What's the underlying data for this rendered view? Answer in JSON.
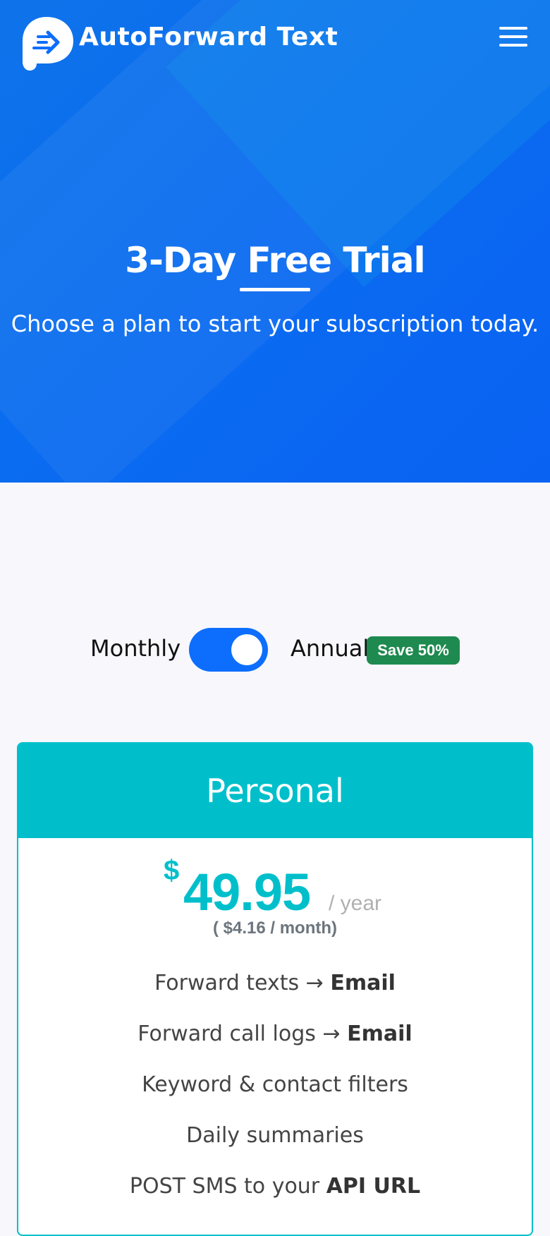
{
  "navbar": {
    "brand": "AutoForward Text",
    "logo_icon": "chat-forward-icon",
    "menu_icon": "hamburger-menu-icon"
  },
  "hero": {
    "title": "3-Day Free Trial",
    "subtitle": "Choose a plan to start your subscription today."
  },
  "billing": {
    "monthly_label": "Monthly",
    "annual_label": "Annual",
    "save_badge": "Save 50%",
    "selected": "Annual",
    "toggle_color": "#0d6efd"
  },
  "plan": {
    "name": "Personal",
    "currency": "$",
    "price": "49.95",
    "period": "/ year",
    "per_month": "( $4.16 / month)",
    "accent_color": "#00bfcb",
    "features": [
      {
        "text": "Forward texts → ",
        "bold": "Email"
      },
      {
        "text": "Forward call logs → ",
        "bold": "Email"
      },
      {
        "text": "Keyword & contact filters",
        "bold": ""
      },
      {
        "text": "Daily summaries",
        "bold": ""
      },
      {
        "text": "POST SMS to your ",
        "bold": "API URL"
      }
    ]
  }
}
